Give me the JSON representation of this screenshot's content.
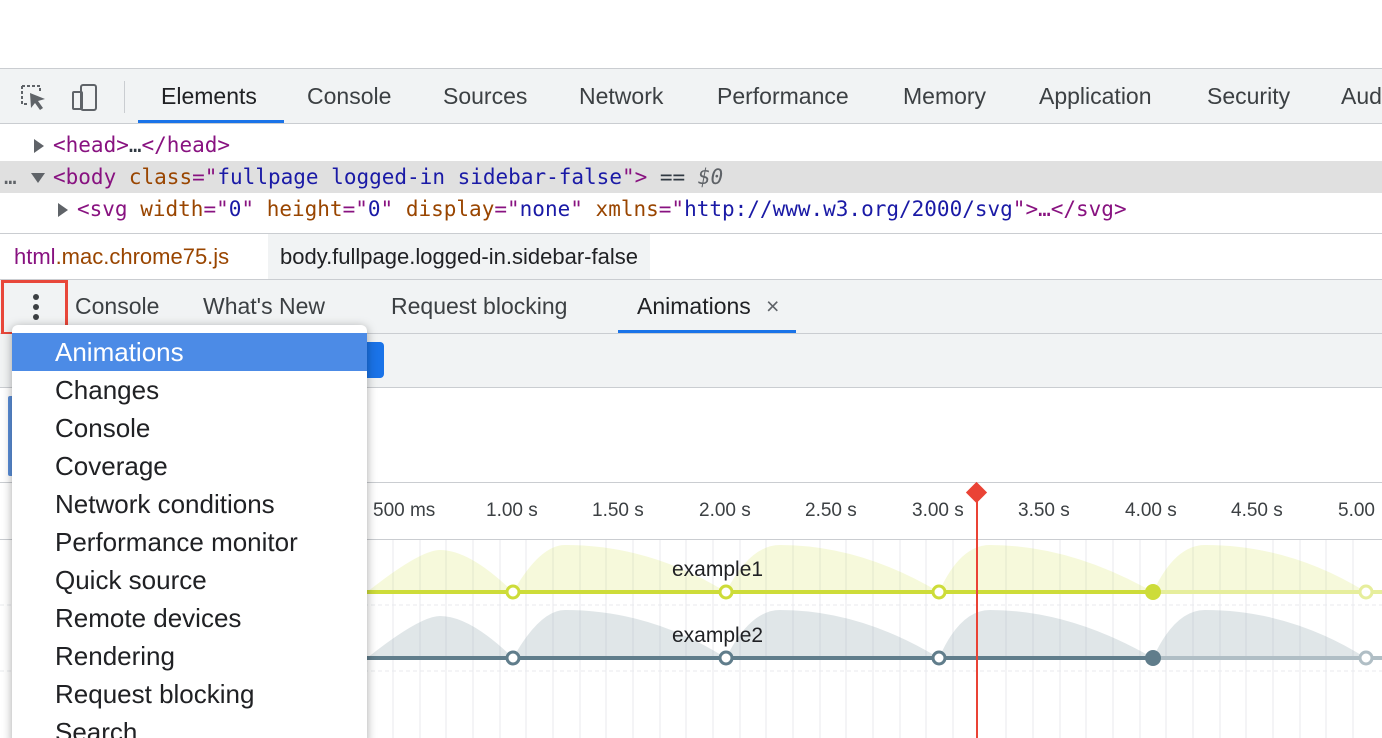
{
  "main_toolbar": {
    "tabs": [
      "Elements",
      "Console",
      "Sources",
      "Network",
      "Performance",
      "Memory",
      "Application",
      "Security",
      "Aud"
    ],
    "active_tab": "Elements",
    "icons": [
      "inspect-element-icon",
      "device-toggle-icon"
    ]
  },
  "dom_tree": {
    "head": {
      "open": "<head>",
      "ellipsis": "…",
      "close": "</head>"
    },
    "body": {
      "prefix_dots": "…",
      "open_tag": "<body",
      "attr_name": "class",
      "eq_quote": "=\"",
      "attr_value": "fullpage logged-in sidebar-false",
      "close_quote": "\">",
      "suffix": " == ",
      "dollar": "$0"
    },
    "svg": {
      "open_tag": "<svg",
      "attrs": [
        {
          "name": "width",
          "value": "0"
        },
        {
          "name": "height",
          "value": "0"
        },
        {
          "name": "display",
          "value": "none"
        },
        {
          "name": "xmlns",
          "value": "http://www.w3.org/2000/svg"
        }
      ],
      "tail": "\">…</svg>"
    }
  },
  "breadcrumb": {
    "html_tag": "html",
    "html_rest": ".mac.chrome75.js",
    "body_crumb": "body.fullpage.logged-in.sidebar-false"
  },
  "drawer": {
    "tabs": [
      "Console",
      "What's New",
      "Request blocking",
      "Animations"
    ],
    "active_tab": "Animations",
    "close_glyph": "×",
    "more_icon": "more-vertical-icon"
  },
  "menu": {
    "items": [
      "Animations",
      "Changes",
      "Console",
      "Coverage",
      "Network conditions",
      "Performance monitor",
      "Quick source",
      "Remote devices",
      "Rendering",
      "Request blocking",
      "Search"
    ],
    "highlighted": "Animations"
  },
  "animations": {
    "ruler_labels": [
      "500 ms",
      "1.00 s",
      "1.50 s",
      "2.00 s",
      "2.50 s",
      "3.00 s",
      "3.50 s",
      "4.00 s",
      "4.50 s",
      "5.00"
    ],
    "rows": [
      {
        "name": "example1",
        "color": "#cddc39"
      },
      {
        "name": "example2",
        "color": "#607d8b"
      }
    ],
    "playhead_color": "#ea4335",
    "accent": "#1a73e8"
  }
}
